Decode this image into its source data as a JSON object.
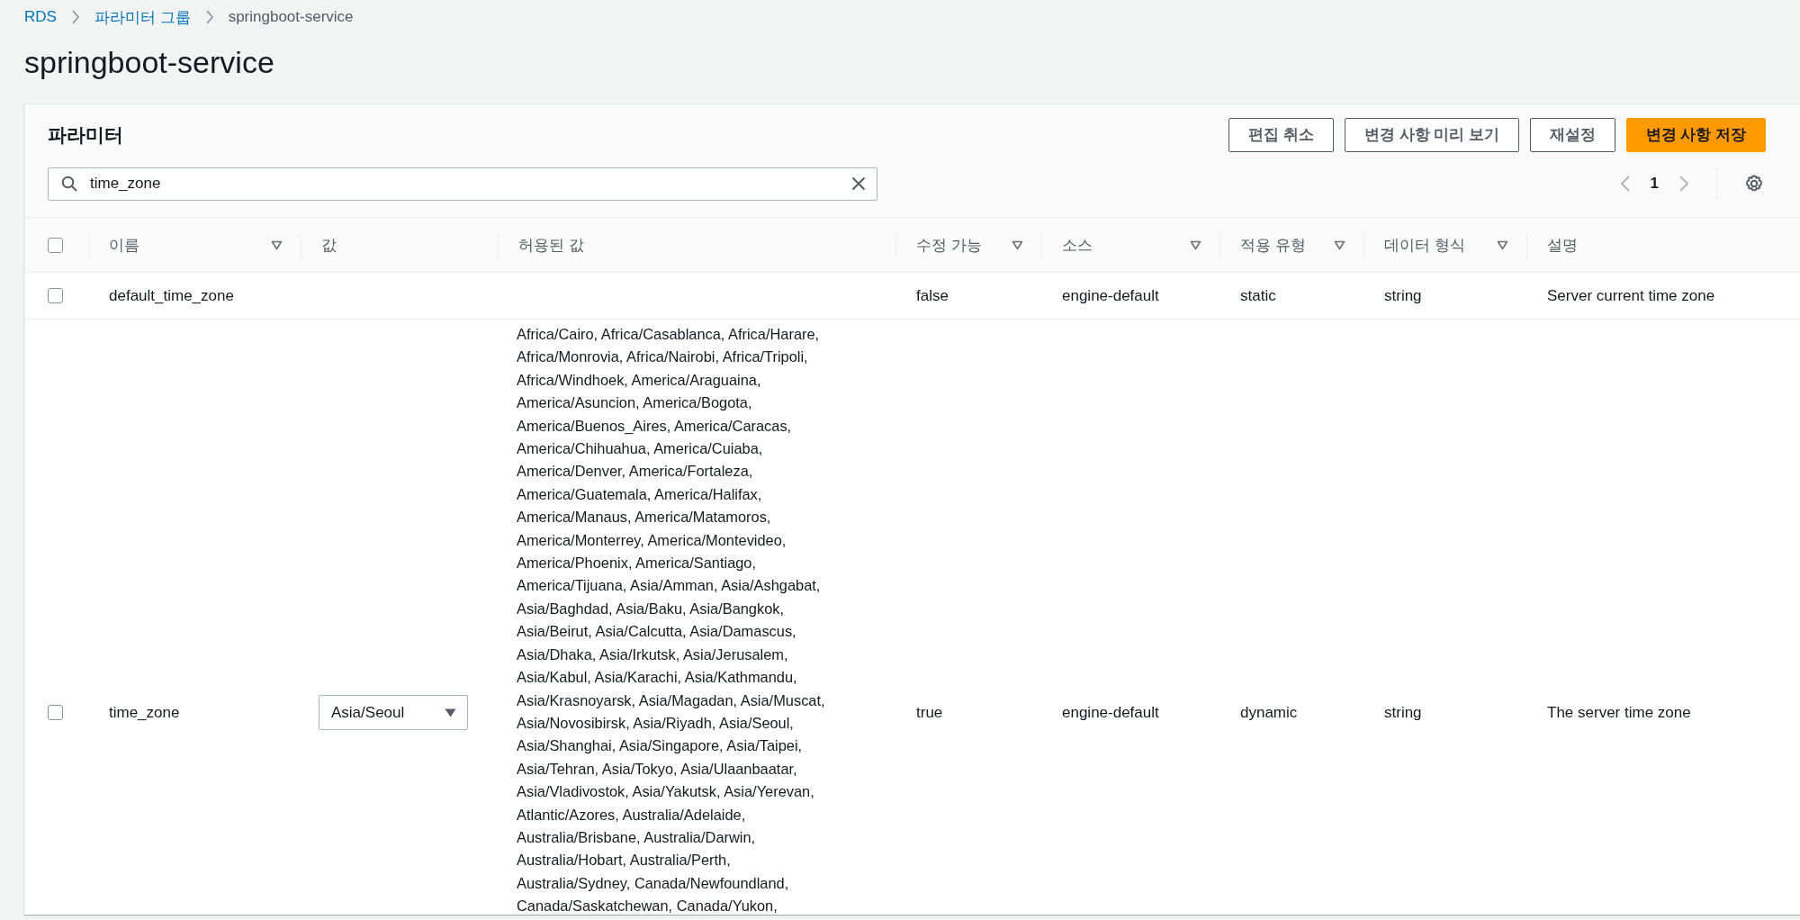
{
  "breadcrumbs": [
    {
      "label": "RDS",
      "kind": "link"
    },
    {
      "label": "파라미터 그룹",
      "kind": "link"
    },
    {
      "label": "springboot-service",
      "kind": "current"
    }
  ],
  "page_title": "springboot-service",
  "panel": {
    "title": "파라미터",
    "buttons": [
      {
        "label": "편집 취소",
        "primary": false
      },
      {
        "label": "변경 사항 미리 보기",
        "primary": false
      },
      {
        "label": "재설정",
        "primary": false
      },
      {
        "label": "변경 사항 저장",
        "primary": true
      }
    ],
    "search": {
      "value": "time_zone"
    },
    "pagination": {
      "page": "1"
    }
  },
  "table": {
    "header_checked": false,
    "columns": [
      {
        "label": "이름",
        "sortable": true
      },
      {
        "label": "값",
        "sortable": false
      },
      {
        "label": "허용된 값",
        "sortable": false
      },
      {
        "label": "수정 가능",
        "sortable": true
      },
      {
        "label": "소스",
        "sortable": true
      },
      {
        "label": "적용 유형",
        "sortable": true
      },
      {
        "label": "데이터 형식",
        "sortable": true
      },
      {
        "label": "설명",
        "sortable": false
      }
    ],
    "rows": [
      {
        "checked": false,
        "name": "default_time_zone",
        "value": {
          "kind": "none"
        },
        "allowed_values": [],
        "editable": "false",
        "source": "engine-default",
        "apply_type": "static",
        "data_type": "string",
        "description": "Server current time zone"
      },
      {
        "checked": false,
        "name": "time_zone",
        "value": {
          "kind": "select",
          "text": "Asia/Seoul"
        },
        "allowed_values": [
          "Africa/Cairo, Africa/Casablanca, Africa/Harare,",
          "Africa/Monrovia, Africa/Nairobi, Africa/Tripoli,",
          "Africa/Windhoek, America/Araguaina,",
          "America/Asuncion, America/Bogota,",
          "America/Buenos_Aires, America/Caracas,",
          "America/Chihuahua, America/Cuiaba,",
          "America/Denver, America/Fortaleza,",
          "America/Guatemala, America/Halifax,",
          "America/Manaus, America/Matamoros,",
          "America/Monterrey, America/Montevideo,",
          "America/Phoenix, America/Santiago,",
          "America/Tijuana, Asia/Amman, Asia/Ashgabat,",
          "Asia/Baghdad, Asia/Baku, Asia/Bangkok,",
          "Asia/Beirut, Asia/Calcutta, Asia/Damascus,",
          "Asia/Dhaka, Asia/Irkutsk, Asia/Jerusalem,",
          "Asia/Kabul, Asia/Karachi, Asia/Kathmandu,",
          "Asia/Krasnoyarsk, Asia/Magadan, Asia/Muscat,",
          "Asia/Novosibirsk, Asia/Riyadh, Asia/Seoul,",
          "Asia/Shanghai, Asia/Singapore, Asia/Taipei,",
          "Asia/Tehran, Asia/Tokyo, Asia/Ulaanbaatar,",
          "Asia/Vladivostok, Asia/Yakutsk, Asia/Yerevan,",
          "Atlantic/Azores, Australia/Adelaide,",
          "Australia/Brisbane, Australia/Darwin,",
          "Australia/Hobart, Australia/Perth,",
          "Australia/Sydney, Canada/Newfoundland,",
          "Canada/Saskatchewan, Canada/Yukon,"
        ],
        "editable": "true",
        "source": "engine-default",
        "apply_type": "dynamic",
        "data_type": "string",
        "description": "The server time zone"
      }
    ]
  }
}
